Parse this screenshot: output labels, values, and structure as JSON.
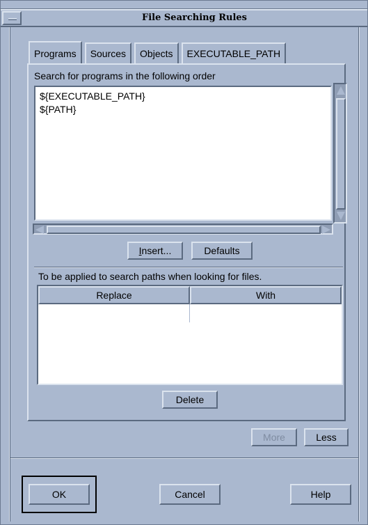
{
  "window": {
    "title": "File Searching Rules"
  },
  "tabs": [
    {
      "label": "Programs",
      "active": true
    },
    {
      "label": "Sources",
      "active": false
    },
    {
      "label": "Objects",
      "active": false
    },
    {
      "label": "EXECUTABLE_PATH",
      "active": false
    }
  ],
  "programs": {
    "order_label": "Search for programs in the following order",
    "entries": [
      "${EXECUTABLE_PATH}",
      "${PATH}"
    ],
    "insert_label_pre": "",
    "insert_label_underlined": "I",
    "insert_label_post": "nsert...",
    "defaults_label": "Defaults"
  },
  "mapping": {
    "apply_label": "To be applied to search paths when looking for files.",
    "columns": [
      "Replace",
      "With"
    ],
    "delete_label": "Delete"
  },
  "options": {
    "more_label": "More",
    "less_label": "Less"
  },
  "actions": {
    "ok_label": "OK",
    "cancel_label": "Cancel",
    "help_label": "Help"
  },
  "colors": {
    "background": "#aab8cf",
    "highlight": "#dbe3ee",
    "shadow": "#5b6a80",
    "disabled_text": "#7f8ca1"
  }
}
